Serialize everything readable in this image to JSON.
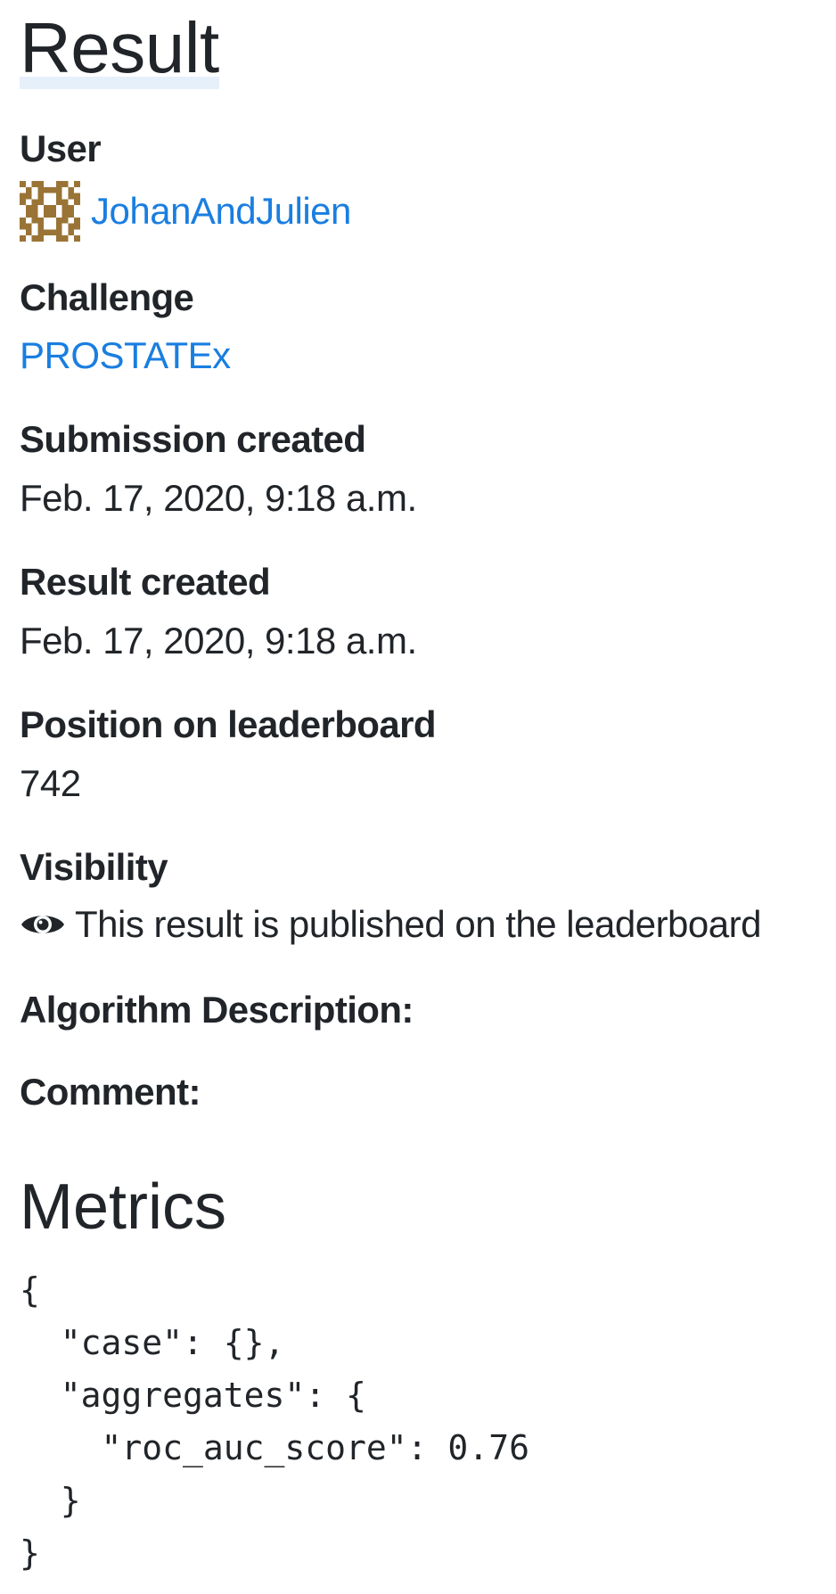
{
  "page": {
    "title": "Result"
  },
  "fields": {
    "user": {
      "label": "User",
      "name": "JohanAndJulien"
    },
    "challenge": {
      "label": "Challenge",
      "name": "PROSTATEx"
    },
    "submission_created": {
      "label": "Submission created",
      "value": "Feb. 17, 2020, 9:18 a.m."
    },
    "result_created": {
      "label": "Result created",
      "value": "Feb. 17, 2020, 9:18 a.m."
    },
    "position": {
      "label": "Position on leaderboard",
      "value": "742"
    },
    "visibility": {
      "label": "Visibility",
      "icon": "eye-icon",
      "text": "This result is published on the leaderboard"
    },
    "algorithm_description": {
      "label": "Algorithm Description:"
    },
    "comment": {
      "label": "Comment:"
    }
  },
  "metrics": {
    "title": "Metrics",
    "json": "{\n  \"case\": {},\n  \"aggregates\": {\n    \"roc_auc_score\": 0.76\n  }\n}"
  },
  "colors": {
    "link": "#1a7ee0",
    "text": "#212529",
    "avatar": "#9a7436"
  }
}
